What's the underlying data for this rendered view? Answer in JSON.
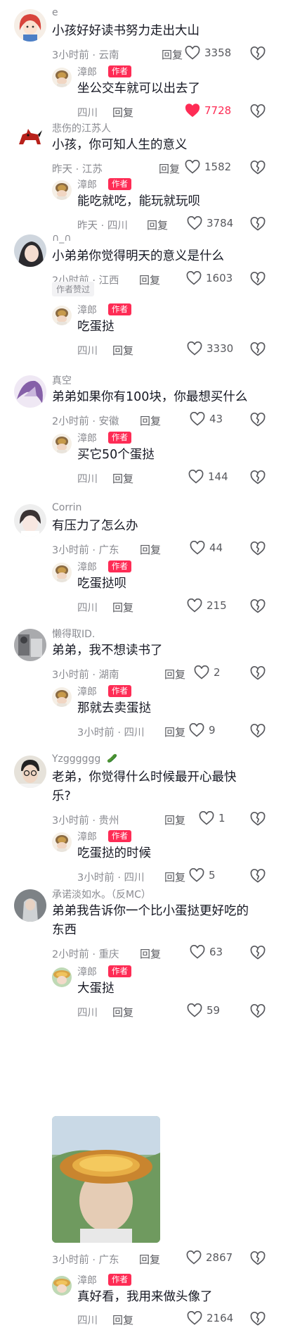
{
  "author_tag": "作者",
  "author_badge": "作者赞过",
  "reply_label": "回复",
  "threads": [
    {
      "name": "e",
      "text": [
        "小孩好好读书努力走出大山"
      ],
      "time": "3小时前 · 云南",
      "likes": "3358",
      "avatar": "red-hair-girl-avatar",
      "reply": {
        "name": "漳郎",
        "text": [
          "坐公交车就可以出去了"
        ],
        "time": "四川",
        "likes": "7728",
        "liked": true
      }
    },
    {
      "name": "悲伤的江苏人",
      "text": [
        "小孩，你可知人生的意义"
      ],
      "time": "昨天 · 江苏",
      "likes": "1582",
      "avatar": "red-horse-avatar",
      "reply": {
        "name": "漳郎",
        "text": [
          "能吃就吃，能玩就玩呗"
        ],
        "time": "昨天 · 四川",
        "likes": "3784"
      }
    },
    {
      "name": "∩_∩",
      "text": [
        "小弟弟你觉得明天的意义是什么"
      ],
      "time": "2小时前 · 江西",
      "likes": "1603",
      "avatar": "girl-photo-avatar",
      "badge": true,
      "reply": {
        "name": "漳郎",
        "text": [
          "吃蛋挞"
        ],
        "time": "四川",
        "likes": "3330"
      }
    },
    {
      "name": "真空",
      "text": [
        "弟弟如果你有100块，你最想买什么"
      ],
      "time": "2小时前 · 安徽",
      "likes": "43",
      "avatar": "purple-anime-avatar",
      "reply": {
        "name": "漳郎",
        "text": [
          "买它50个蛋挞"
        ],
        "time": "四川",
        "likes": "144"
      }
    },
    {
      "name": "Corrin",
      "text": [
        "有压力了怎么办"
      ],
      "time": "3小时前 · 广东",
      "likes": "44",
      "avatar": "anime-boy-avatar",
      "reply": {
        "name": "漳郎",
        "text": [
          "吃蛋挞呗"
        ],
        "time": "四川",
        "likes": "215"
      }
    },
    {
      "name": "懒得取ID.",
      "text": [
        "弟弟，我不想读书了"
      ],
      "time": "3小时前 · 湖南",
      "likes": "2",
      "avatar": "gray-photo-avatar",
      "reply": {
        "name": "漳郎",
        "text": [
          "那就去卖蛋挞"
        ],
        "time": "3小时前 · 四川",
        "likes": "9"
      }
    },
    {
      "name": "Yzgggggg",
      "name_icon": "green-leaf-icon",
      "text": [
        "老弟，你觉得什么时候最开心最快",
        "乐?"
      ],
      "time": "3小时前 · 贵州",
      "likes": "1",
      "avatar": "glasses-boy-avatar",
      "reply": {
        "name": "漳郎",
        "text": [
          "吃蛋挞的时候"
        ],
        "time": "3小时前 · 四川",
        "likes": "5"
      }
    },
    {
      "name": "承诺淡如水。（反MC）",
      "text": [
        "弟弟我告诉你一个比小蛋挞更好吃的",
        "东西"
      ],
      "time": "2小时前 · 重庆",
      "likes": "63",
      "avatar": "dark-photo-avatar",
      "reply": {
        "name": "漳郎",
        "text": [
          "大蛋挞"
        ],
        "time": "四川",
        "likes": "59",
        "avatar_style": "eggtart-hat-avatar"
      }
    }
  ],
  "photo_post": {
    "image": "child-with-egg-tart-hat-photo",
    "time": "3小时前 · 广东",
    "likes": "2867"
  },
  "final_reply": {
    "name": "漳郎",
    "text": [
      "真好看，我用来做头像了"
    ],
    "time": "四川",
    "likes": "2164",
    "avatar_style": "eggtart-hat-avatar"
  },
  "colors": {
    "accent": "#fe2c55",
    "meta": "#8a8b91",
    "text": "#161823"
  }
}
